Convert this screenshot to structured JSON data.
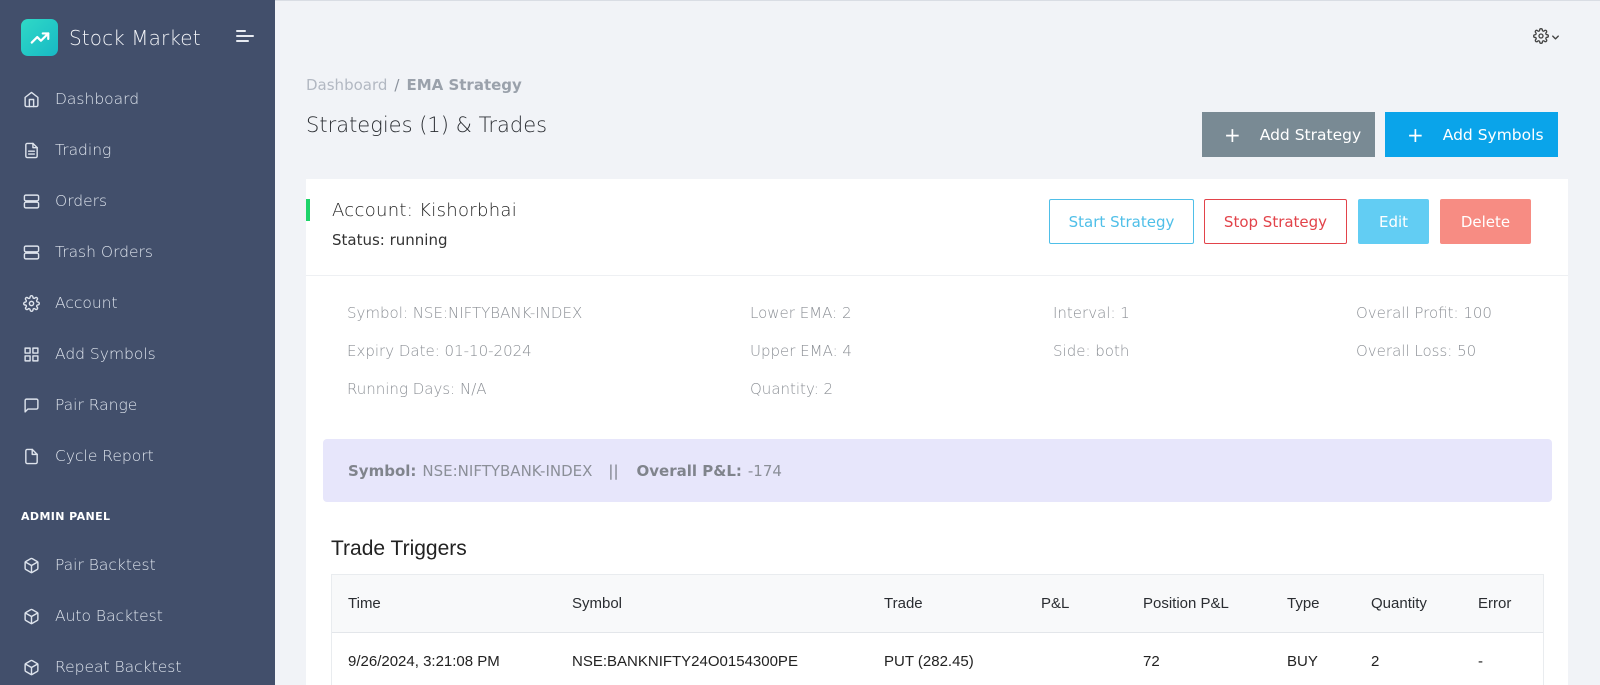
{
  "app": {
    "name": "Stock Market"
  },
  "sidebar": {
    "items": [
      {
        "label": "Dashboard",
        "icon": "home-icon"
      },
      {
        "label": "Trading",
        "icon": "document-icon"
      },
      {
        "label": "Orders",
        "icon": "server-icon"
      },
      {
        "label": "Trash Orders",
        "icon": "server-icon"
      },
      {
        "label": "Account",
        "icon": "gear-icon"
      },
      {
        "label": "Add Symbols",
        "icon": "grid-icon"
      },
      {
        "label": "Pair Range",
        "icon": "message-square-icon"
      },
      {
        "label": "Cycle Report",
        "icon": "file-icon"
      }
    ],
    "admin_heading": "ADMIN PANEL",
    "admin_items": [
      {
        "label": "Pair Backtest",
        "icon": "box-icon"
      },
      {
        "label": "Auto Backtest",
        "icon": "box-icon"
      },
      {
        "label": "Repeat Backtest",
        "icon": "box-icon"
      }
    ]
  },
  "breadcrumb": {
    "home": "Dashboard",
    "separator": "/",
    "current": "EMA Strategy"
  },
  "page": {
    "title": "Strategies (1) & Trades"
  },
  "actions": {
    "add_strategy": "Add Strategy",
    "add_symbols": "Add Symbols",
    "plus": "+"
  },
  "strategy": {
    "account_label": "Account: Kishorbhai",
    "status_label": "Status: running",
    "buttons": {
      "start": "Start Strategy",
      "stop": "Stop Strategy",
      "edit": "Edit",
      "delete": "Delete"
    },
    "details": {
      "symbol": "Symbol: NSE:NIFTYBANK-INDEX",
      "expiry": "Expiry Date: 01-10-2024",
      "running_days": "Running Days: N/A",
      "lower_ema": "Lower EMA: 2",
      "upper_ema": "Upper EMA: 4",
      "quantity": "Quantity: 2",
      "interval": "Interval: 1",
      "side": "Side: both",
      "overall_profit": "Overall Profit: 100",
      "overall_loss": "Overall Loss: 50"
    },
    "summary": {
      "symbol_label": "Symbol:",
      "symbol_value": "NSE:NIFTYBANK-INDEX",
      "separator": "||",
      "pnl_label": "Overall P&L:",
      "pnl_value": "-174"
    }
  },
  "trade_triggers": {
    "title": "Trade Triggers",
    "columns": [
      "Time",
      "Symbol",
      "Trade",
      "P&L",
      "Position P&L",
      "Type",
      "Quantity",
      "Error"
    ],
    "rows": [
      [
        "9/26/2024, 3:21:08 PM",
        "NSE:BANKNIFTY24O0154300PE",
        "PUT (282.45)",
        "",
        "72",
        "BUY",
        "2",
        "-"
      ]
    ]
  },
  "colors": {
    "sidebar_bg": "#424f6b",
    "accent_green": "#1ed36a",
    "primary_blue": "#0aa4ea",
    "secondary_gray": "#798a94",
    "danger_red": "#e2434a",
    "info_blue": "#62cdf3",
    "delete_salmon": "#f78c83",
    "summary_bg": "#e7e6fb"
  }
}
